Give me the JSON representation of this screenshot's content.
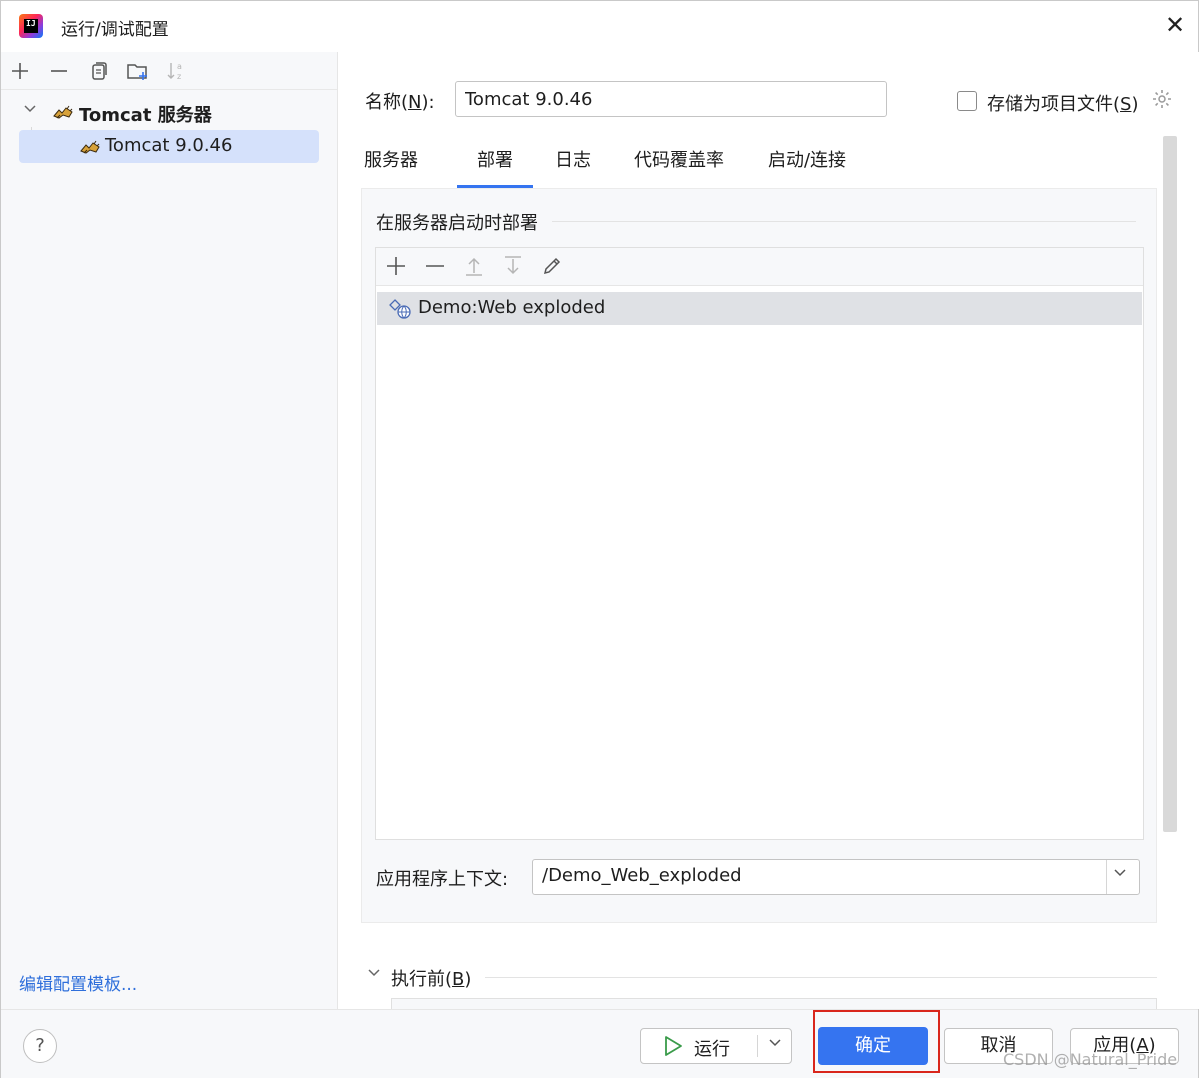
{
  "window": {
    "title": "运行/调试配置",
    "close_symbol": "✕"
  },
  "left": {
    "toolbar": [
      {
        "name": "add-icon",
        "glyph": "+"
      },
      {
        "name": "remove-icon",
        "glyph": "—"
      },
      {
        "name": "copy-icon",
        "glyph": "⧉"
      },
      {
        "name": "new-folder-icon",
        "glyph": "🗀"
      },
      {
        "name": "sort-icon",
        "glyph": "↓ᵃz"
      }
    ],
    "tree": {
      "group_label": "Tomcat 服务器",
      "item_label": "Tomcat 9.0.46"
    },
    "edit_templates_link": "编辑配置模板..."
  },
  "form": {
    "name_label_prefix": "名称(",
    "name_label_mnemonic": "N",
    "name_label_suffix": "):",
    "name_value": "Tomcat 9.0.46",
    "store_label_prefix": "存储为项目文件(",
    "store_label_mnemonic": "S",
    "store_label_suffix": ")",
    "store_checked": false
  },
  "tabs": [
    {
      "label": "服务器",
      "active": false
    },
    {
      "label": "部署",
      "active": true
    },
    {
      "label": "日志",
      "active": false
    },
    {
      "label": "代码覆盖率",
      "active": false
    },
    {
      "label": "启动/连接",
      "active": false
    }
  ],
  "deploy": {
    "section_title": "在服务器启动时部署",
    "toolbar": [
      "add-icon",
      "remove-icon",
      "move-up-icon",
      "move-down-icon",
      "edit-icon"
    ],
    "artifacts": [
      "Demo:Web exploded"
    ],
    "context_label": "应用程序上下文:",
    "context_value": "/Demo_Web_exploded"
  },
  "before_launch": {
    "label_prefix": "执行前(",
    "label_mnemonic": "B",
    "label_suffix": ")"
  },
  "footer": {
    "help": "?",
    "run_label": "运行",
    "ok_label": "确定",
    "cancel_label": "取消",
    "apply_label_prefix": "应用(",
    "apply_label_mnemonic": "A",
    "apply_label_suffix": ")",
    "watermark": "CSDN @Natural_Pride"
  },
  "colors": {
    "accent": "#3574f0",
    "selection": "#d5e1fb",
    "highlight_box": "#d9261c"
  }
}
